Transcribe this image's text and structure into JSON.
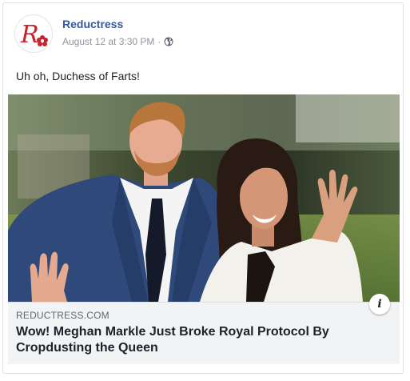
{
  "post": {
    "page_name": "Reductress",
    "timestamp": "August 12 at 3:30 PM",
    "separator": "·",
    "privacy_icon": "globe-icon",
    "text": "Uh oh, Duchess of Farts!"
  },
  "link_preview": {
    "domain": "REDUCTRESS.COM",
    "headline": "Wow! Meghan Markle Just Broke Royal Protocol By Cropdusting the Queen",
    "info_label": "i"
  },
  "colors": {
    "page_name": "#365899",
    "meta": "#90949c",
    "brand_red": "#c8232c",
    "link_bg": "#f2f3f5"
  }
}
